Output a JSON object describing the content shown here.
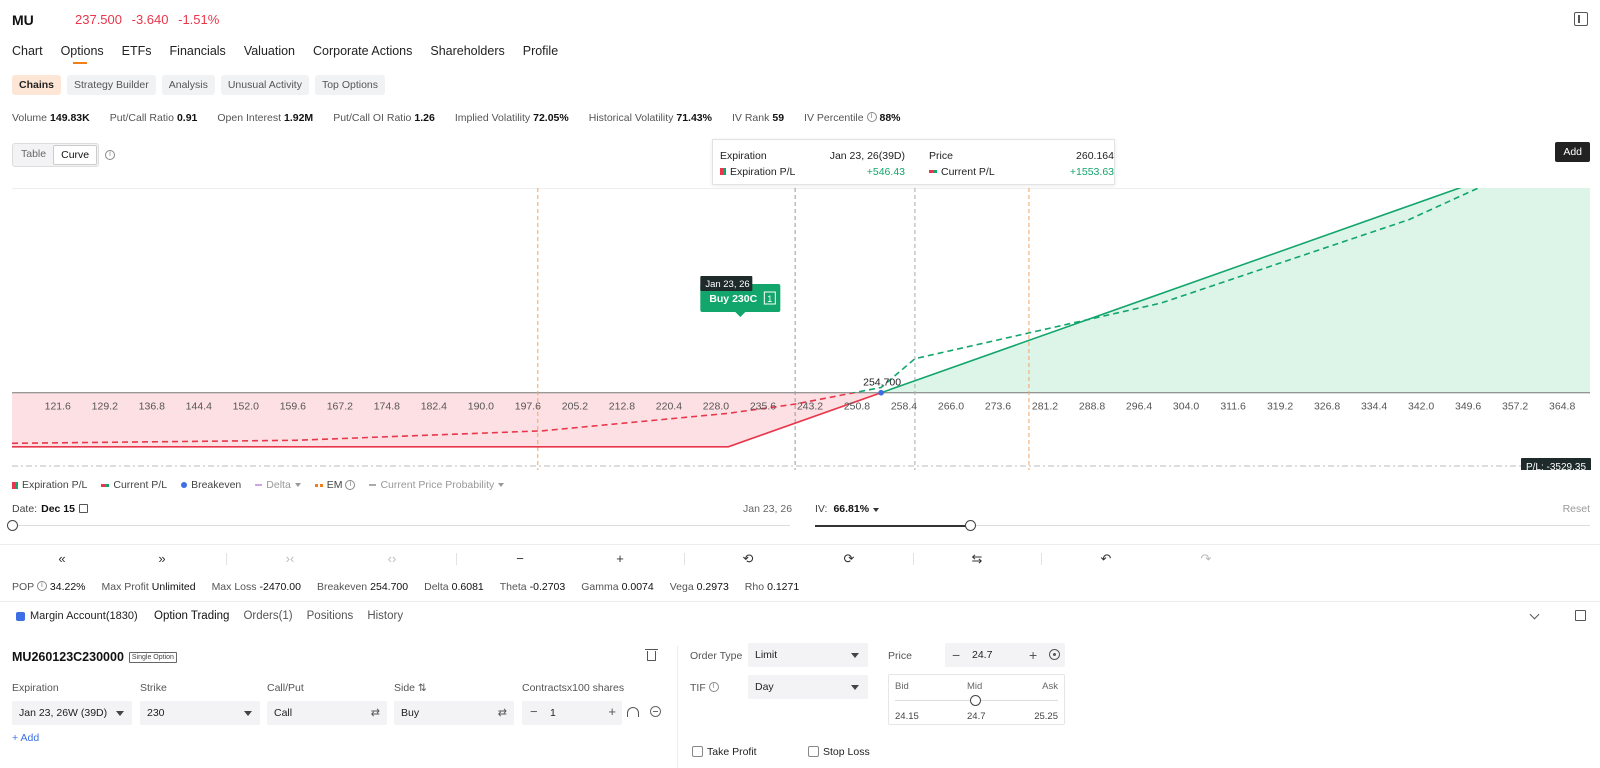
{
  "header": {
    "symbol": "MU",
    "price": "237.500",
    "change": "-3.640",
    "change_pct": "-1.51%"
  },
  "main_tabs": [
    "Chart",
    "Options",
    "ETFs",
    "Financials",
    "Valuation",
    "Corporate Actions",
    "Shareholders",
    "Profile"
  ],
  "main_tab_active": "Options",
  "sub_tabs": [
    "Chains",
    "Strategy Builder",
    "Analysis",
    "Unusual Activity",
    "Top Options"
  ],
  "sub_tab_active": "Chains",
  "stats": [
    {
      "label": "Volume",
      "value": "149.83K"
    },
    {
      "label": "Put/Call Ratio",
      "value": "0.91"
    },
    {
      "label": "Open Interest",
      "value": "1.92M"
    },
    {
      "label": "Put/Call OI Ratio",
      "value": "1.26"
    },
    {
      "label": "Implied Volatility",
      "value": "72.05%"
    },
    {
      "label": "Historical Volatility",
      "value": "71.43%"
    },
    {
      "label": "IV Rank",
      "value": "59"
    },
    {
      "label": "IV Percentile",
      "value": "88%"
    }
  ],
  "view_toggle": {
    "table": "Table",
    "curve": "Curve",
    "active": "Curve"
  },
  "add_button": "Add",
  "tooltip": {
    "expiration_label": "Expiration",
    "expiration_value": "Jan 23, 26(39D)",
    "exp_pl_label": "Expiration P/L",
    "exp_pl_value": "+546.43",
    "price_label": "Price",
    "price_value": "260.164",
    "cur_pl_label": "Current P/L",
    "cur_pl_value": "+1553.63"
  },
  "chart_data": {
    "type": "line",
    "x_ticks": [
      "121.6",
      "129.2",
      "136.8",
      "144.4",
      "152.0",
      "159.6",
      "167.2",
      "174.8",
      "182.4",
      "190.0",
      "197.6",
      "205.2",
      "212.8",
      "220.4",
      "228.0",
      "235.6",
      "243.2",
      "250.8",
      "258.4",
      "266.0",
      "273.6",
      "281.2",
      "288.8",
      "296.4",
      "304.0",
      "311.6",
      "319.2",
      "326.8",
      "334.4",
      "342.0",
      "349.6",
      "357.2",
      "364.8"
    ],
    "xlim": [
      114.2,
      369.3
    ],
    "ylim": [
      -3529.35,
      9350
    ],
    "breakeven": 254.7,
    "breakeven_label": "254.700",
    "strike": 230,
    "cursor_x": 260.164,
    "hover_x": 240.8,
    "em_lines": [
      199.2,
      278.6
    ],
    "pl_label": "P/L: -3529.35",
    "position_label": "Buy 230C",
    "position_qty": "1",
    "position_date": "Jan 23, 26",
    "series": [
      {
        "name": "Expiration P/L",
        "points": [
          [
            114.2,
            -2470
          ],
          [
            230,
            -2470
          ],
          [
            254.7,
            0
          ],
          [
            369.3,
            11460
          ]
        ]
      },
      {
        "name": "Current P/L",
        "points": [
          [
            114.2,
            -2312
          ],
          [
            160,
            -2175
          ],
          [
            200,
            -1740
          ],
          [
            230,
            -940
          ],
          [
            240.8,
            -520
          ],
          [
            254.7,
            240
          ],
          [
            260.164,
            1553.63
          ],
          [
            300,
            4100
          ],
          [
            340,
            7900
          ],
          [
            369.3,
            11680
          ]
        ]
      }
    ]
  },
  "legend": {
    "expiration": "Expiration P/L",
    "current": "Current P/L",
    "breakeven": "Breakeven",
    "delta": "Delta",
    "em": "EM",
    "prob": "Current Price Probability"
  },
  "date_slider": {
    "label": "Date:",
    "value": "Dec 15",
    "end": "Jan 23, 26",
    "position": 0
  },
  "iv_slider": {
    "label": "IV:",
    "value": "66.81%",
    "reset": "Reset",
    "position": 0.2
  },
  "toolbar": {
    "rewind": "«",
    "forward": "»",
    "shrink": "›‹",
    "expand": "‹›",
    "minus": "−",
    "plus": "+",
    "history": "⟲",
    "redo_time": "⟳",
    "swap": "⇆",
    "undo": "↶",
    "redo": "↷"
  },
  "greeks": [
    {
      "label": "POP",
      "value": "34.22%"
    },
    {
      "label": "Max Profit",
      "value": "Unlimited"
    },
    {
      "label": "Max Loss",
      "value": "-2470.00"
    },
    {
      "label": "Breakeven",
      "value": "254.700"
    },
    {
      "label": "Delta",
      "value": "0.6081"
    },
    {
      "label": "Theta",
      "value": "-0.2703"
    },
    {
      "label": "Gamma",
      "value": "0.0074"
    },
    {
      "label": "Vega",
      "value": "0.2973"
    },
    {
      "label": "Rho",
      "value": "0.1271"
    }
  ],
  "account": "Margin Account(1830)",
  "trade_tabs": [
    "Option Trading",
    "Orders(1)",
    "Positions",
    "History"
  ],
  "trade_tab_active": "Option Trading",
  "contract": {
    "code": "MU260123C230000",
    "badge": "Single Option"
  },
  "leg": {
    "expiration_label": "Expiration",
    "expiration_value": "Jan 23, 26W (39D)",
    "strike_label": "Strike",
    "strike_value": "230",
    "callput_label": "Call/Put",
    "callput_value": "Call",
    "side_label": "Side ⇅",
    "side_value": "Buy",
    "contracts_label": "Contractsx100 shares",
    "contracts_value": "1",
    "add_link": "+ Add"
  },
  "order": {
    "type_label": "Order Type",
    "type_value": "Limit",
    "tif_label": "TIF",
    "tif_value": "Day",
    "price_label": "Price",
    "price_value": "24.7",
    "bid_label": "Bid",
    "mid_label": "Mid",
    "ask_label": "Ask",
    "bid": "24.15",
    "mid": "24.7",
    "ask": "25.25",
    "take_profit": "Take Profit",
    "stop_loss": "Stop Loss"
  }
}
